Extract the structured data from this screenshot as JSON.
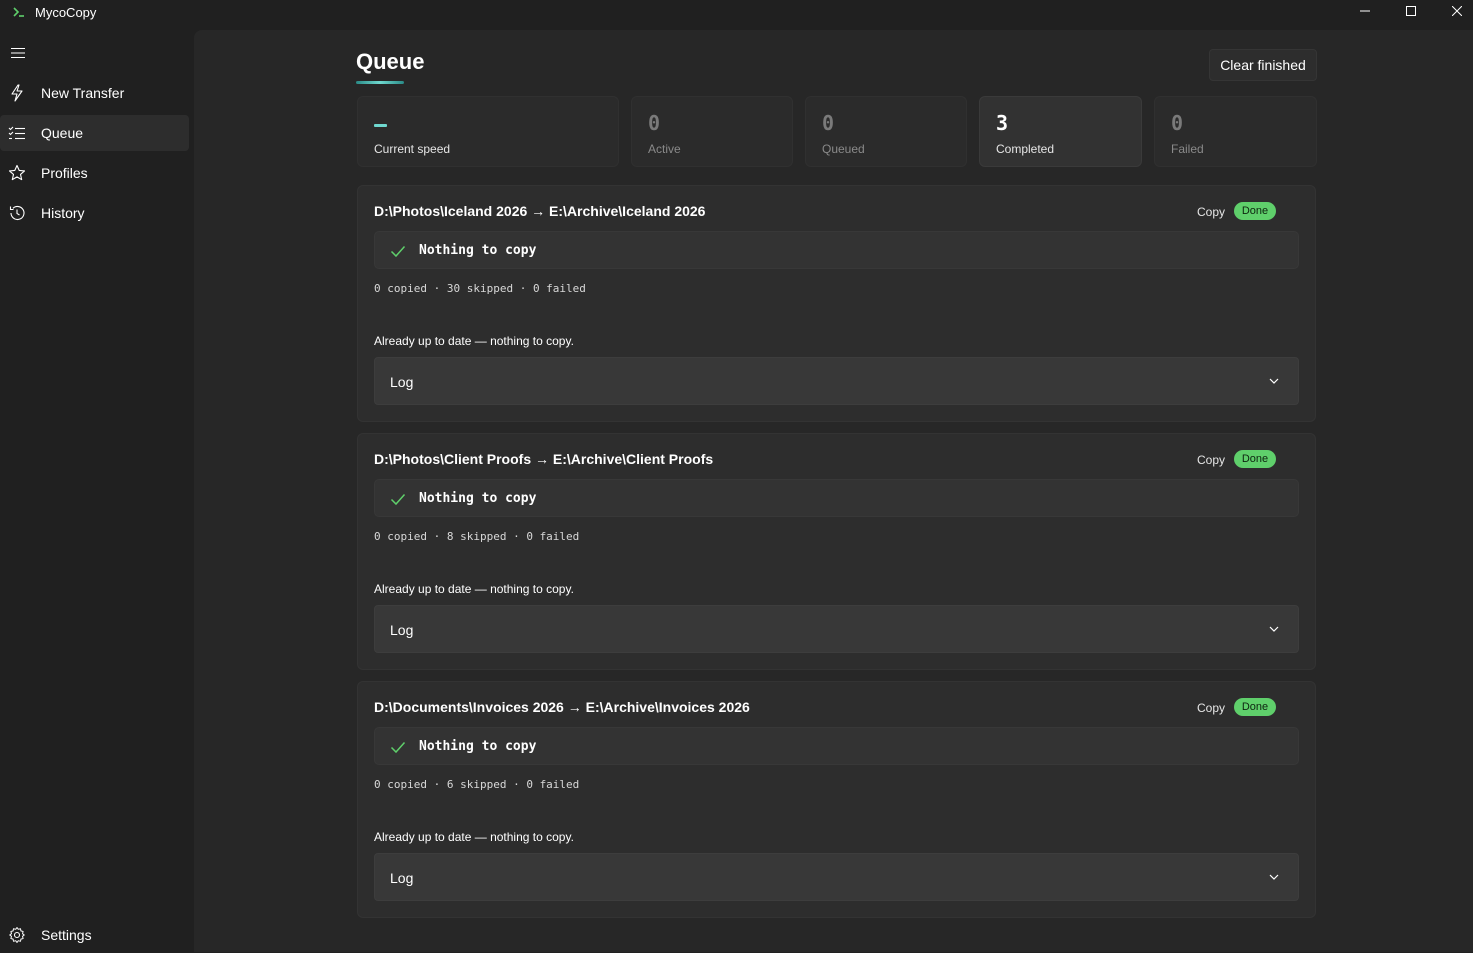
{
  "app": {
    "title": "MycoCopy"
  },
  "sidebar": {
    "items": [
      {
        "label": "New Transfer",
        "icon": "lightning-icon"
      },
      {
        "label": "Queue",
        "icon": "queue-list-icon"
      },
      {
        "label": "Profiles",
        "icon": "star-icon"
      },
      {
        "label": "History",
        "icon": "history-icon"
      }
    ],
    "settings_label": "Settings"
  },
  "page": {
    "title": "Queue",
    "clear_button": "Clear finished"
  },
  "stats": [
    {
      "value": "",
      "label": "Current speed"
    },
    {
      "value": "0",
      "label": "Active"
    },
    {
      "value": "0",
      "label": "Queued"
    },
    {
      "value": "3",
      "label": "Completed"
    },
    {
      "value": "0",
      "label": "Failed"
    }
  ],
  "jobs": [
    {
      "path": "D:\\Photos\\Iceland 2026  →  E:\\Archive\\Iceland 2026",
      "type": "Copy",
      "status": "Done",
      "result": "Nothing to copy",
      "counts": "0 copied · 30 skipped · 0 failed",
      "message": "Already up to date — nothing to copy.",
      "log_label": "Log"
    },
    {
      "path": "D:\\Photos\\Client Proofs  →  E:\\Archive\\Client Proofs",
      "type": "Copy",
      "status": "Done",
      "result": "Nothing to copy",
      "counts": "0 copied · 8 skipped · 0 failed",
      "message": "Already up to date — nothing to copy.",
      "log_label": "Log"
    },
    {
      "path": "D:\\Documents\\Invoices 2026  →  E:\\Archive\\Invoices 2026",
      "type": "Copy",
      "status": "Done",
      "result": "Nothing to copy",
      "counts": "0 copied · 6 skipped · 0 failed",
      "message": "Already up to date — nothing to copy.",
      "log_label": "Log"
    }
  ],
  "colors": {
    "accent": "#6fd8cf",
    "done_badge": "#5fcf6b",
    "check": "#5fcf6b"
  }
}
